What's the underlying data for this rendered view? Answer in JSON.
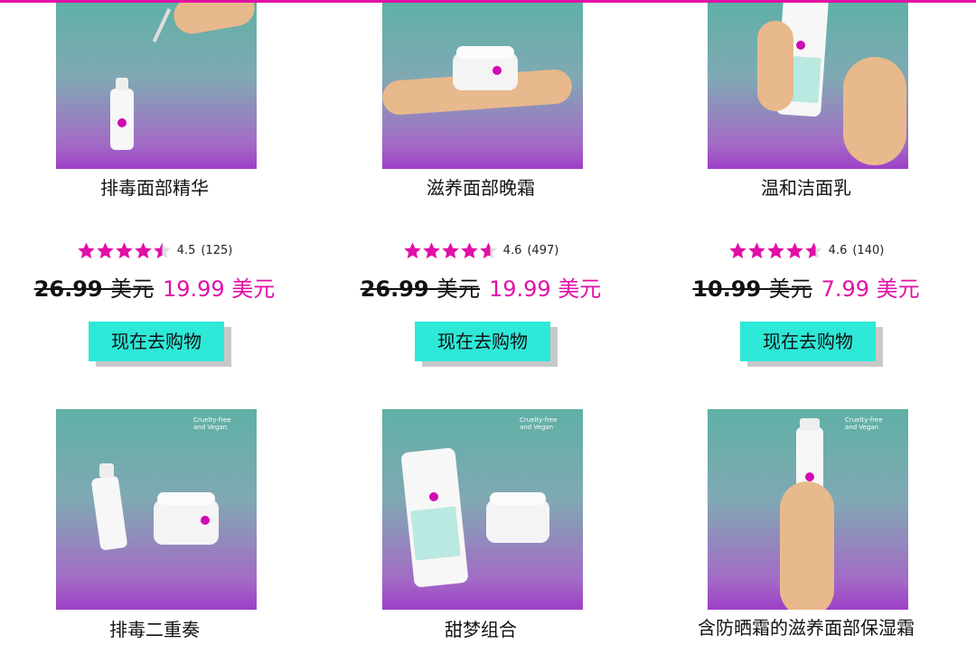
{
  "accent_color": "#e10fa6",
  "button_color": "#2ee8d8",
  "products": [
    {
      "name": "排毒面部精华",
      "rating": "4.5",
      "reviews": "(125)",
      "stars_fill": 0.9,
      "old_price_num": "26.99",
      "old_price_unit": "美元",
      "new_price": "19.99 美元",
      "button": "现在去购物"
    },
    {
      "name": "滋养面部晚霜",
      "rating": "4.6",
      "reviews": "(497)",
      "stars_fill": 0.92,
      "old_price_num": "26.99",
      "old_price_unit": "美元",
      "new_price": "19.99 美元",
      "button": "现在去购物"
    },
    {
      "name": "温和洁面乳",
      "rating": "4.6",
      "reviews": "(140)",
      "stars_fill": 0.92,
      "old_price_num": "10.99",
      "old_price_unit": "美元",
      "new_price": "7.99 美元",
      "button": "现在去购物"
    },
    {
      "name": "排毒二重奏",
      "badge": "Cruelty-free and Vegan"
    },
    {
      "name": "甜梦组合",
      "badge": "Cruelty-free and Vegan"
    },
    {
      "name": "含防晒霜的滋养面部保湿霜",
      "badge": "Cruelty-free and Vegan"
    }
  ],
  "product_image_icons": [
    "serum-dropper-image",
    "night-cream-jar-image",
    "cleanser-tube-image",
    "detox-duo-image",
    "sweet-dreams-set-image",
    "spf-moisturizer-image"
  ]
}
